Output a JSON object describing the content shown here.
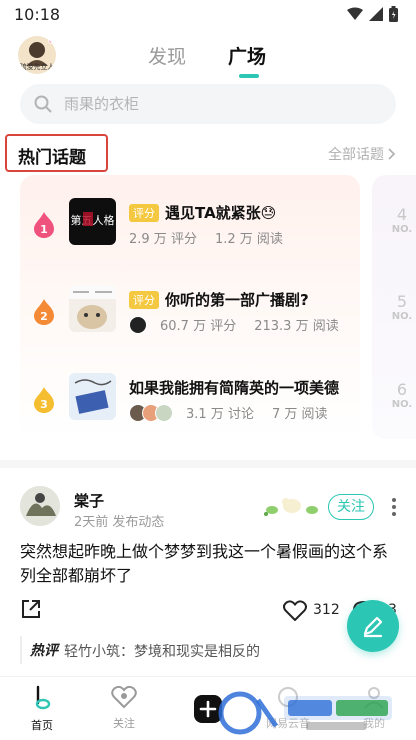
{
  "status_bar": {
    "time": "10:18"
  },
  "header": {
    "avatar_caption": "疏浚先立人",
    "tabs": [
      {
        "label": "发现",
        "active": false
      },
      {
        "label": "广场",
        "active": true
      }
    ]
  },
  "search": {
    "placeholder": "雨果的衣柜"
  },
  "hot_topics": {
    "title": "热门话题",
    "all_link": "全部话题",
    "items": [
      {
        "rank": "1",
        "tag": "评分",
        "title": "遇见TA就紧张😓",
        "stat1": "2.9 万 评分",
        "stat2": "1.2 万 阅读",
        "thumb_label": "第五人格",
        "rank_color": "#f0527e"
      },
      {
        "rank": "2",
        "tag": "评分",
        "title": "你听的第一部广播剧?",
        "stat1": "60.7 万 评分",
        "stat2": "213.3 万 阅读",
        "thumb_label": "",
        "rank_color": "#f58a36"
      },
      {
        "rank": "3",
        "tag": "",
        "title": "如果我能拥有简隋英的一项美德",
        "stat1": "3.1 万 讨论",
        "stat2": "7 万 阅读",
        "thumb_label": "",
        "rank_color": "#f5bd30"
      }
    ],
    "next_ranks": [
      {
        "num": "4",
        "no": "NO."
      },
      {
        "num": "5",
        "no": "NO."
      },
      {
        "num": "6",
        "no": "NO."
      }
    ]
  },
  "post": {
    "author": "棠子",
    "time": "2天前 发布动态",
    "follow_label": "关注",
    "text": "突然想起昨晚上做个梦梦到我这一个暑假画的这个系列全部都崩坏了",
    "likes": "312",
    "comments": "3",
    "hot_comment_tag": "热评",
    "hot_comment": "轻竹小筑：梦境和现实是相反的"
  },
  "bottom_nav": {
    "items": [
      {
        "label": "首页",
        "active": true
      },
      {
        "label": "关注",
        "active": false
      },
      {
        "label": "网易云音",
        "active": false
      },
      {
        "label": "我的",
        "active": false
      }
    ]
  },
  "colors": {
    "accent": "#2cc6b4",
    "highlight_box": "#d9453a",
    "tag": "#f5c842"
  }
}
